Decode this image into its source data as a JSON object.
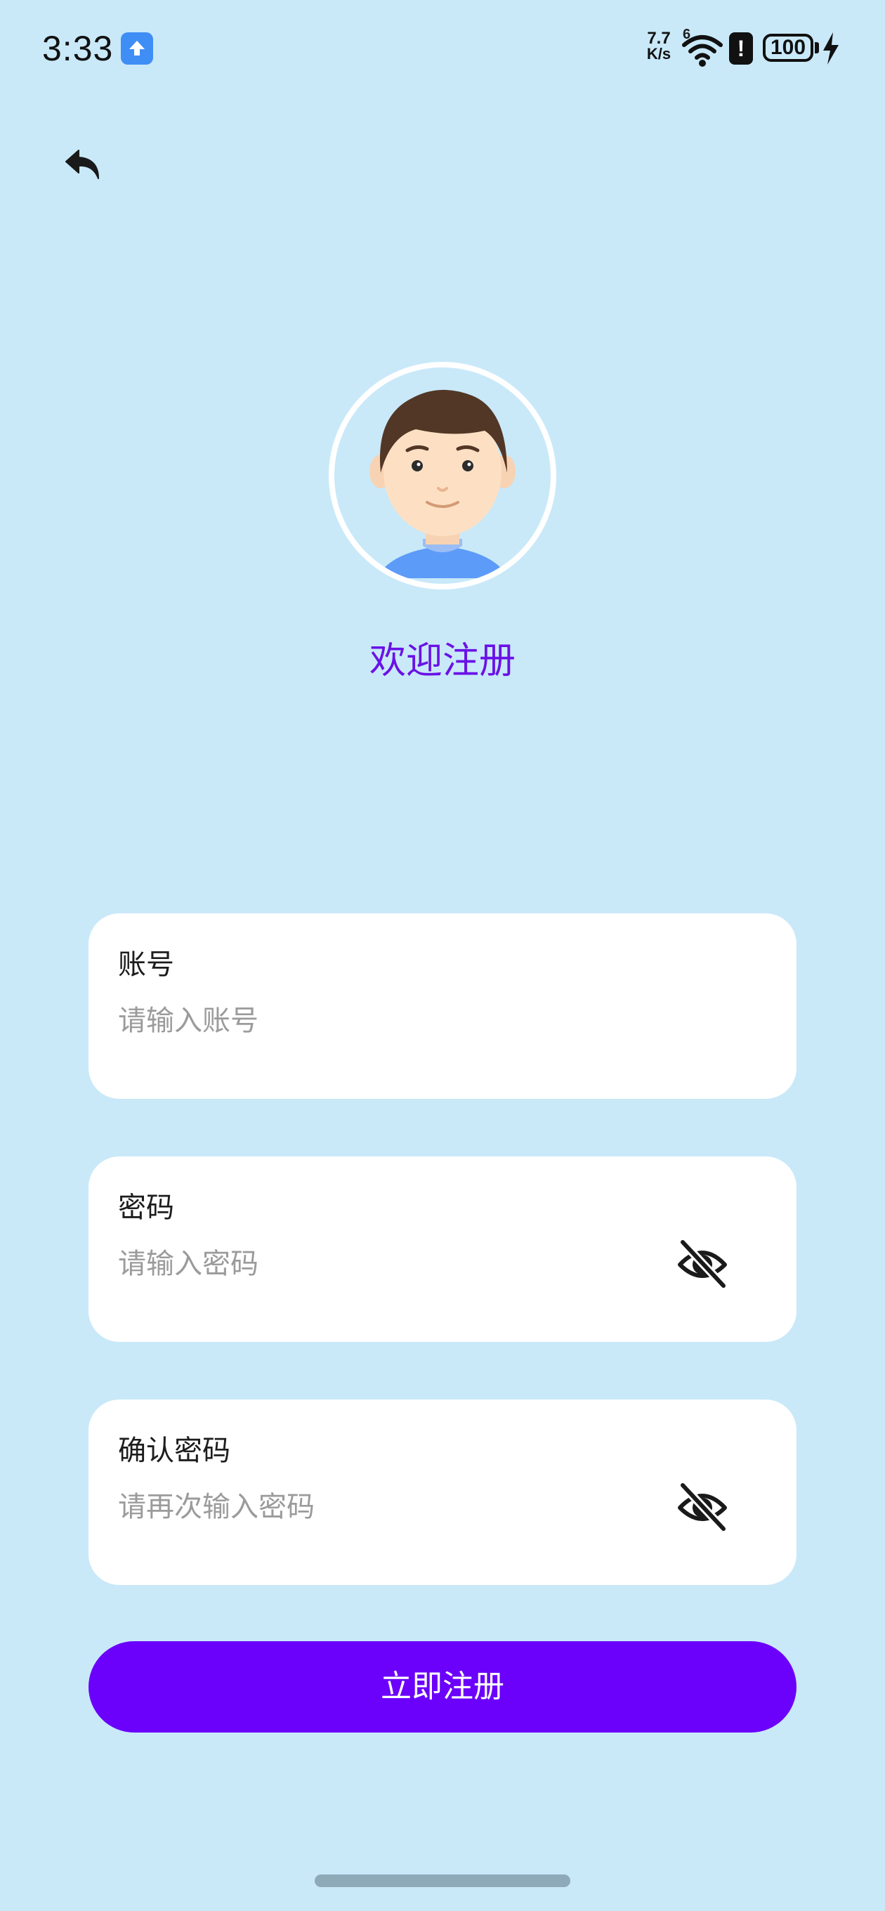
{
  "status_bar": {
    "time": "3:33",
    "net_speed_value": "7.7",
    "net_speed_unit": "K/s",
    "signal_label": "6",
    "battery_level": "100",
    "alert_glyph": "!"
  },
  "header": {
    "back_icon": "undo-arrow-icon"
  },
  "profile": {
    "title": "欢迎注册"
  },
  "form": {
    "account": {
      "label": "账号",
      "placeholder": "请输入账号",
      "value": ""
    },
    "password": {
      "label": "密码",
      "placeholder": "请输入密码",
      "value": ""
    },
    "confirm_password": {
      "label": "确认密码",
      "placeholder": "请再次输入密码",
      "value": ""
    },
    "submit_label": "立即注册"
  },
  "colors": {
    "background": "#c9e9f9",
    "accent": "#6b00fb",
    "title": "#6a12e6"
  }
}
